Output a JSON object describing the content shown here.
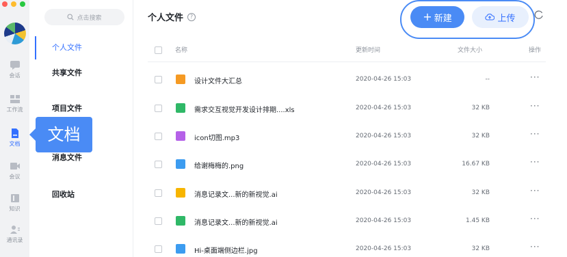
{
  "colors": {
    "accent": "#3370ff",
    "button_blue": "#4a8bf5",
    "traffic_red": "#ff5f57",
    "traffic_yellow": "#febc2e",
    "traffic_green": "#28c840"
  },
  "rail": {
    "items": [
      {
        "label": "会话",
        "icon": "chat-icon"
      },
      {
        "label": "工作流",
        "icon": "workflow-icon"
      },
      {
        "label": "文档",
        "icon": "document-icon",
        "active": true
      },
      {
        "label": "会议",
        "icon": "video-icon"
      },
      {
        "label": "知识",
        "icon": "knowledge-icon"
      },
      {
        "label": "通讯录",
        "icon": "contacts-icon"
      }
    ]
  },
  "sidebar": {
    "search_placeholder": "点击搜索",
    "items": [
      {
        "label": "个人文件",
        "active": true
      },
      {
        "label": "共享文件"
      },
      {
        "label": "项目文件"
      },
      {
        "label": "消息文件"
      },
      {
        "label": "回收站"
      }
    ]
  },
  "tooltip": {
    "text": "文档"
  },
  "header": {
    "title": "个人文件",
    "help_icon": "?",
    "new_button": "新建",
    "upload_button": "上传"
  },
  "table": {
    "columns": {
      "name": "名称",
      "updated": "更新时间",
      "size": "文件大小",
      "actions": "操作"
    },
    "rows": [
      {
        "name": "设计文件大汇总",
        "updated": "2020-04-26 15:03",
        "size": "--",
        "icon": "folder-icon",
        "color": "#f59a23"
      },
      {
        "name": "需求交互视觉开发设计排期....xls",
        "updated": "2020-04-26 15:03",
        "size": "32 KB",
        "icon": "excel-icon",
        "color": "#2fb867"
      },
      {
        "name": "icon切图.mp3",
        "updated": "2020-04-26 15:03",
        "size": "32 KB",
        "icon": "audio-icon",
        "color": "#b561e8"
      },
      {
        "name": "给谢梅梅的.png",
        "updated": "2020-04-26 15:03",
        "size": "16.67 KB",
        "icon": "image-icon",
        "color": "#3c9cf0"
      },
      {
        "name": "消息记录文...新的新视觉.ai",
        "updated": "2020-04-26 15:03",
        "size": "32 KB",
        "icon": "ai-icon",
        "color": "#f7b500"
      },
      {
        "name": "消息记录文...新的新视觉.ai",
        "updated": "2020-04-26 15:03",
        "size": "1.45 KB",
        "icon": "excel-icon",
        "color": "#2fb867"
      },
      {
        "name": "Hi-桌面端侧边栏.jpg",
        "updated": "2020-04-26 15:03",
        "size": "32 KB",
        "icon": "image-icon",
        "color": "#3c9cf0"
      }
    ],
    "more_label": "···"
  }
}
